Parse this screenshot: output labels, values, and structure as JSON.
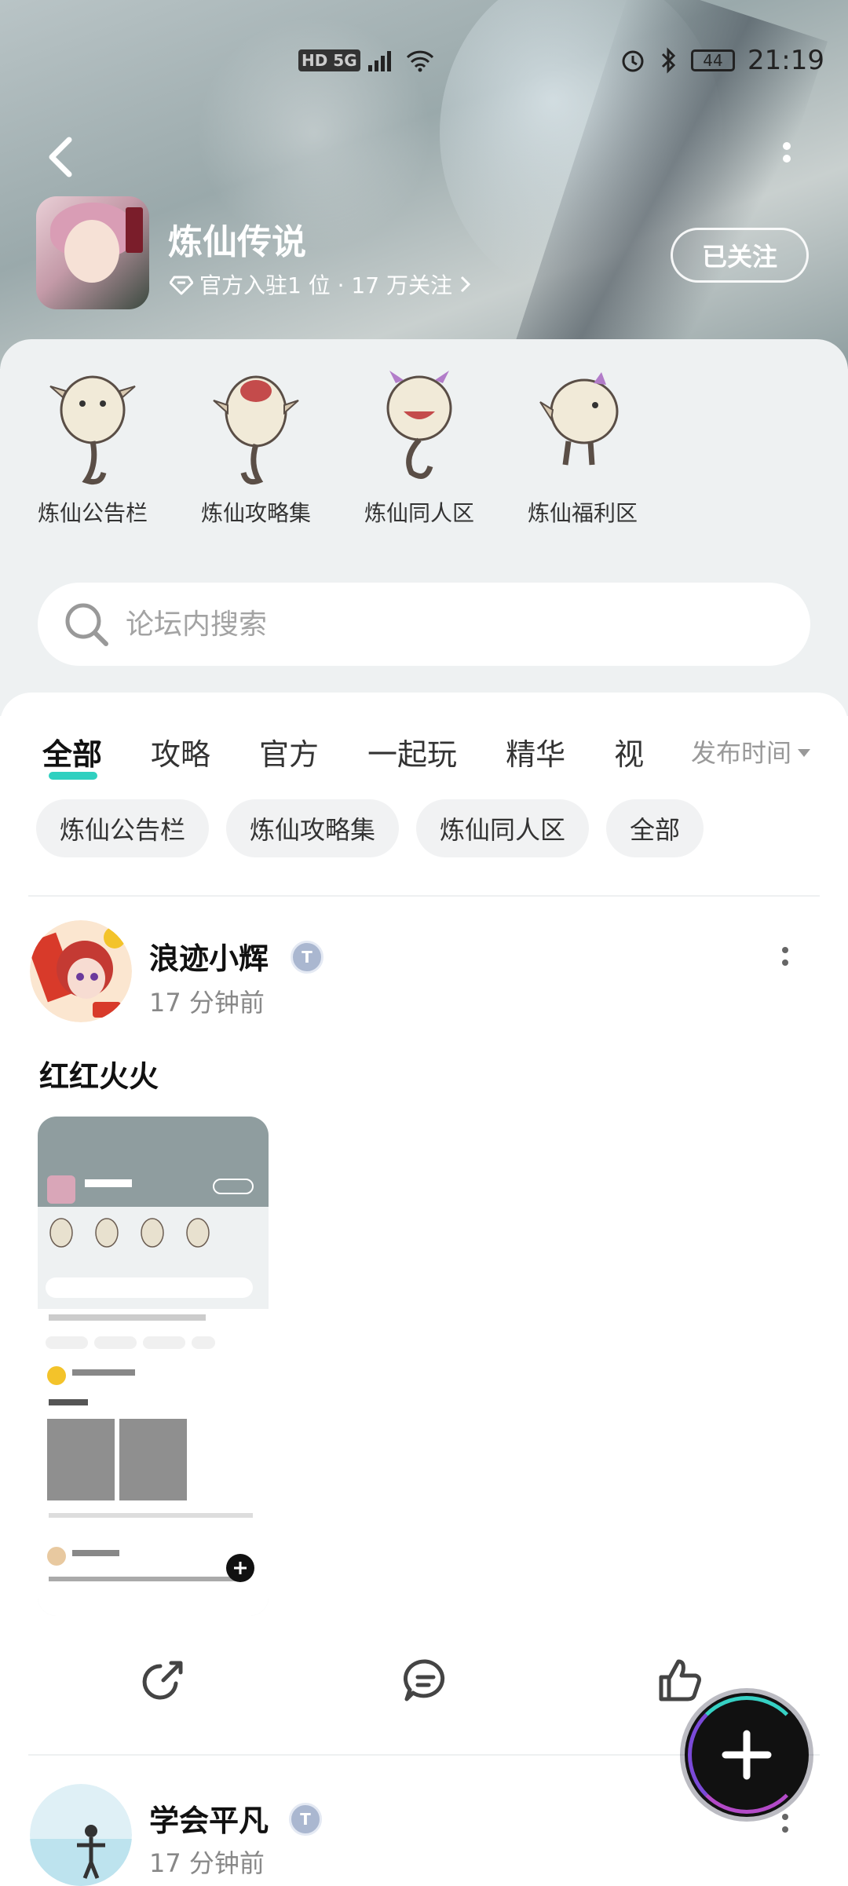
{
  "status_bar": {
    "left": "HD 5G",
    "battery": "44",
    "time": "21:19"
  },
  "header": {
    "title": "炼仙传说",
    "subline": "官方入驻1 位 · 17 万关注",
    "follow_label": "已关注"
  },
  "boards": [
    {
      "label": "炼仙公告栏"
    },
    {
      "label": "炼仙攻略集"
    },
    {
      "label": "炼仙同人区"
    },
    {
      "label": "炼仙福利区"
    }
  ],
  "search": {
    "placeholder": "论坛内搜索"
  },
  "tabs": [
    "全部",
    "攻略",
    "官方",
    "一起玩",
    "精华",
    "视"
  ],
  "sort": {
    "label": "发布时间"
  },
  "chips": [
    "炼仙公告栏",
    "炼仙攻略集",
    "炼仙同人区",
    "全部"
  ],
  "posts": [
    {
      "username": "浪迹小辉",
      "time": "17 分钟前",
      "title": "红红火火"
    },
    {
      "username": "学会平凡",
      "time": "17 分钟前"
    }
  ],
  "colors": {
    "accent": "#2fd0c0",
    "fab": "#111111"
  }
}
